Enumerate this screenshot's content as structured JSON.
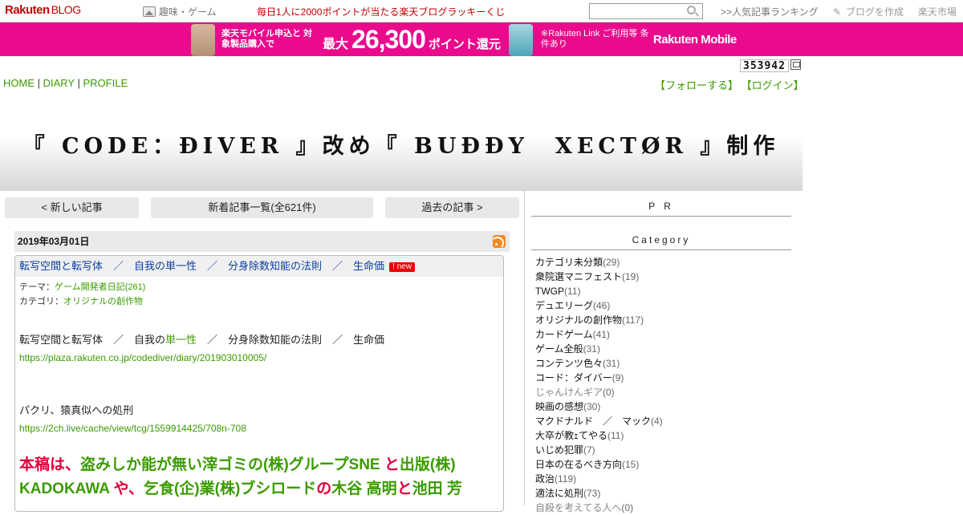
{
  "topbar": {
    "logo_main": "Rakuten",
    "logo_sub": "BLOG",
    "category_link": "趣味・ゲーム",
    "lucky_text": "毎日1人に2000ポイントが当たる楽天ブログラッキーくじ",
    "ranking_link": ">>人気記事ランキング",
    "create_link": "ブログを作成",
    "ichiba_link": "楽天市場"
  },
  "ad": {
    "text_left": "楽天モバイル申込と 対象製品購入で",
    "prefix": "最大",
    "amount": "26,300",
    "suffix": "ポイント還元",
    "text_right": "※Rakuten Link ご利用等 条件あり",
    "brand": "Rakuten Mobile",
    "bg_color": "#ea0a8c"
  },
  "counter": "353942",
  "nav": {
    "home": "HOME",
    "diary": "DIARY",
    "profile": "PROFILE",
    "follow": "【フォローする】",
    "login": "【ログイン】"
  },
  "site_title": "『 CODE：ĐIVER 』改め『 BUĐĐY　XECTØR 』制作",
  "pager": {
    "newer": "< 新しい記事",
    "list": "新着記事一覧(全621件)",
    "older": "過去の記事 >"
  },
  "entry": {
    "date": "2019年03月01日",
    "title": "転写空間と転写体　／　自我の単一性　／　分身除数知能の法則　／　生命価",
    "new_badge": "! new",
    "theme_label": "テーマ：",
    "theme_value": "ゲーム開発者日記(261)",
    "category_label": "カテゴリ：",
    "category_value": "オリジナルの創作物",
    "line1_a": "転写空間と転写体　／　自我の",
    "line1_b": "単一性",
    "line1_c": "　／　分身除数知能の法則　／　生命価",
    "url1": "https://plaza.rakuten.co.jp/codediver/diary/201903010005/",
    "line2": "パクリ、猿真似への処刑",
    "url2": "https://2ch.live/cache/view/tcg/1559914425/708n-708",
    "big1_a": "本稿は、",
    "big1_b": "盗みしか能が無い滓ゴミの(株)グループSNE",
    "big1_c": " と",
    "big1_d": "出版(株)",
    "big2_a": "KADOKAWA",
    "big2_b": " や、",
    "big2_c": "乞食(企)業(株)ブシロード",
    "big2_d": "の",
    "big2_e": "木谷 高明",
    "big2_f": "と",
    "big2_g": "池田 芳"
  },
  "sidebar": {
    "pr": "P R",
    "category_heading": "Category",
    "categories": [
      {
        "name": "カテゴリ未分類",
        "count": "(29)"
      },
      {
        "name": "衆院選マニフェスト",
        "count": "(19)"
      },
      {
        "name": "TWGP",
        "count": "(11)"
      },
      {
        "name": "デュエリーグ",
        "count": "(46)"
      },
      {
        "name": "オリジナルの創作物",
        "count": "(117)"
      },
      {
        "name": "カードゲーム",
        "count": "(41)"
      },
      {
        "name": "ゲーム全般",
        "count": "(31)"
      },
      {
        "name": "コンテンツ色々",
        "count": "(31)"
      },
      {
        "name": "コード：ダイバー",
        "count": "(9)"
      },
      {
        "name": "じゃんけんギア",
        "count": "(0)"
      },
      {
        "name": "映画の感想",
        "count": "(30)"
      },
      {
        "name": "マクドナルド　／　マック",
        "count": "(4)"
      },
      {
        "name": "大卒が教ｪてやる",
        "count": "(11)"
      },
      {
        "name": "いじめ犯罪",
        "count": "(7)"
      },
      {
        "name": "日本の在るべき方向",
        "count": "(15)"
      },
      {
        "name": "政治",
        "count": "(119)"
      },
      {
        "name": "適法に処刑",
        "count": "(73)"
      },
      {
        "name": "自殺を考えてる人へ",
        "count": "(0)"
      }
    ]
  }
}
